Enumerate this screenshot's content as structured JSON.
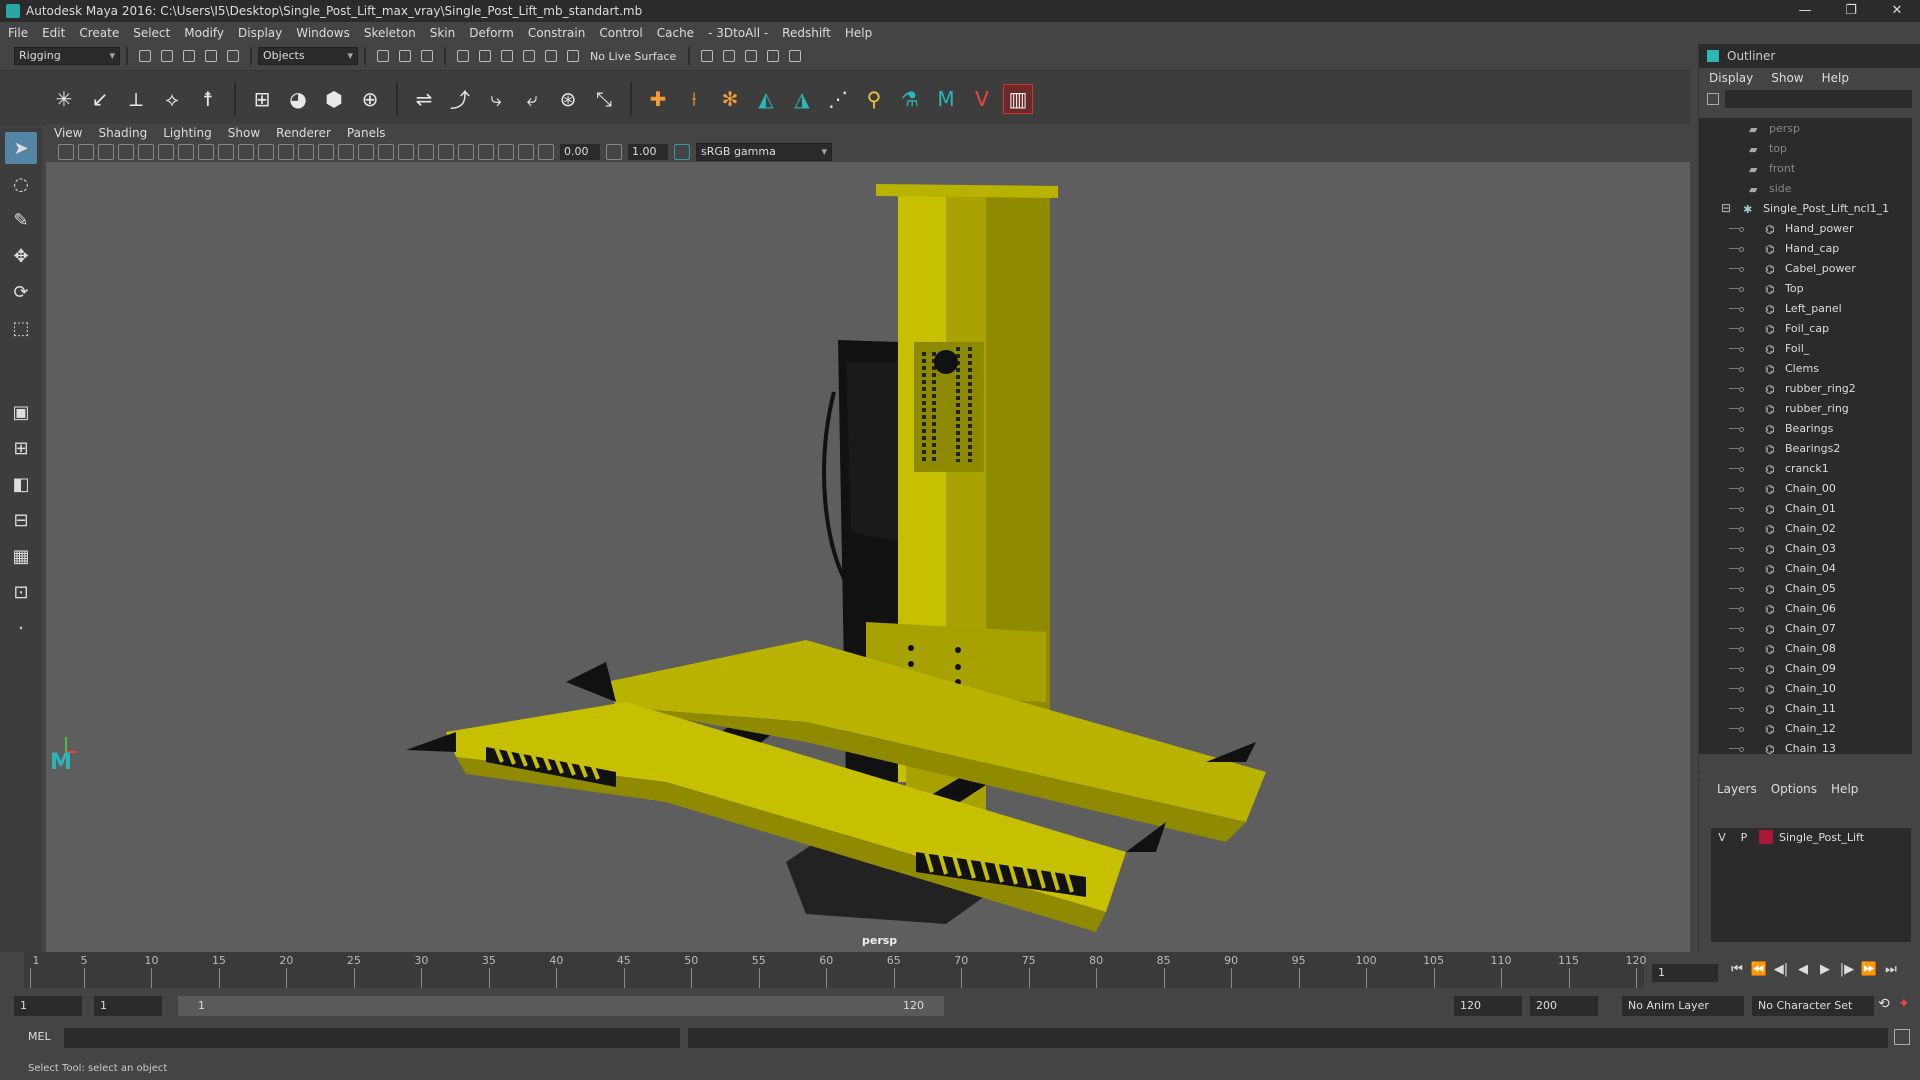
{
  "title": "Autodesk Maya 2016: C:\\Users\\I5\\Desktop\\Single_Post_Lift_max_vray\\Single_Post_Lift_mb_standart.mb",
  "window_controls": {
    "minimize": "—",
    "restore": "❐",
    "close": "✕"
  },
  "menus": [
    "File",
    "Edit",
    "Create",
    "Select",
    "Modify",
    "Display",
    "Windows",
    "Skeleton",
    "Skin",
    "Deform",
    "Constrain",
    "Control",
    "Cache",
    "- 3DtoAll -",
    "Redshift",
    "Help"
  ],
  "status_line": {
    "menu_set": "Rigging",
    "selection_mode": "Objects",
    "live_surface": "No Live Surface"
  },
  "viewport": {
    "menus": [
      "View",
      "Shading",
      "Lighting",
      "Show",
      "Renderer",
      "Panels"
    ],
    "exposure": "0.00",
    "gamma": "1.00",
    "color_space": "sRGB gamma",
    "camera_label": "persp"
  },
  "outliner": {
    "title": "Outliner",
    "menus": [
      "Display",
      "Show",
      "Help"
    ],
    "cameras": [
      "persp",
      "top",
      "front",
      "side"
    ],
    "root": "Single_Post_Lift_ncl1_1",
    "children": [
      "Hand_power",
      "Hand_cap",
      "Cabel_power",
      "Top",
      "Left_panel",
      "Foil_cap",
      "Foil_",
      "Clems",
      "rubber_ring2",
      "rubber_ring",
      "Bearings",
      "Bearings2",
      "cranck1",
      "Chain_00",
      "Chain_01",
      "Chain_02",
      "Chain_03",
      "Chain_04",
      "Chain_05",
      "Chain_06",
      "Chain_07",
      "Chain_08",
      "Chain_09",
      "Chain_10",
      "Chain_11",
      "Chain_12",
      "Chain_13"
    ]
  },
  "layers": {
    "menus": [
      "Layers",
      "Options",
      "Help"
    ],
    "row": {
      "v": "V",
      "p": "P",
      "name": "Single_Post_Lift",
      "color": "#a8163a"
    }
  },
  "timeline": {
    "ticks": [
      1,
      5,
      10,
      15,
      20,
      25,
      30,
      35,
      40,
      45,
      50,
      55,
      60,
      65,
      70,
      75,
      80,
      85,
      90,
      95,
      100,
      105,
      110,
      115,
      120
    ],
    "current_frame": "1"
  },
  "range": {
    "start": "1",
    "playback_start": "1",
    "slider_start": "1",
    "slider_end": "120",
    "playback_end": "120",
    "end": "200",
    "anim_layer": "No Anim Layer",
    "character_set": "No Character Set"
  },
  "command_line": {
    "label": "MEL"
  },
  "help_line": "Select Tool: select an object"
}
